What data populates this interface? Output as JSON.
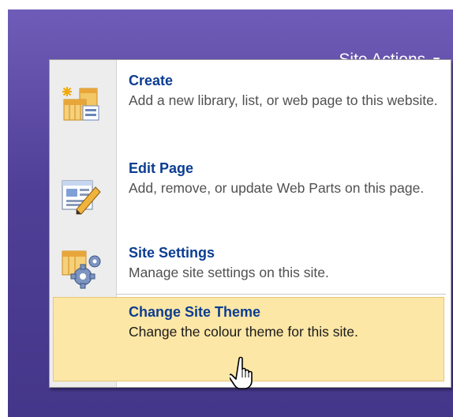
{
  "header": {
    "site_actions_label": "Site Actions",
    "site_actions_caret_icon": "caret-down-icon"
  },
  "menu": {
    "items": [
      {
        "title": "Create",
        "description": "Add a new library, list, or web page to this website.",
        "icon": "create-icon"
      },
      {
        "title": "Edit Page",
        "description": "Add, remove, or update Web Parts on this page.",
        "icon": "edit-page-icon"
      },
      {
        "title": "Site Settings",
        "description": "Manage site settings on this site.",
        "icon": "site-settings-icon"
      },
      {
        "title": "Change Site Theme",
        "description": "Change the colour theme for this site.",
        "icon": "",
        "highlighted": true
      }
    ]
  },
  "colors": {
    "background_purple": "#5a48a6",
    "title_blue": "#0b3d91",
    "highlight": "#fde7a6"
  }
}
